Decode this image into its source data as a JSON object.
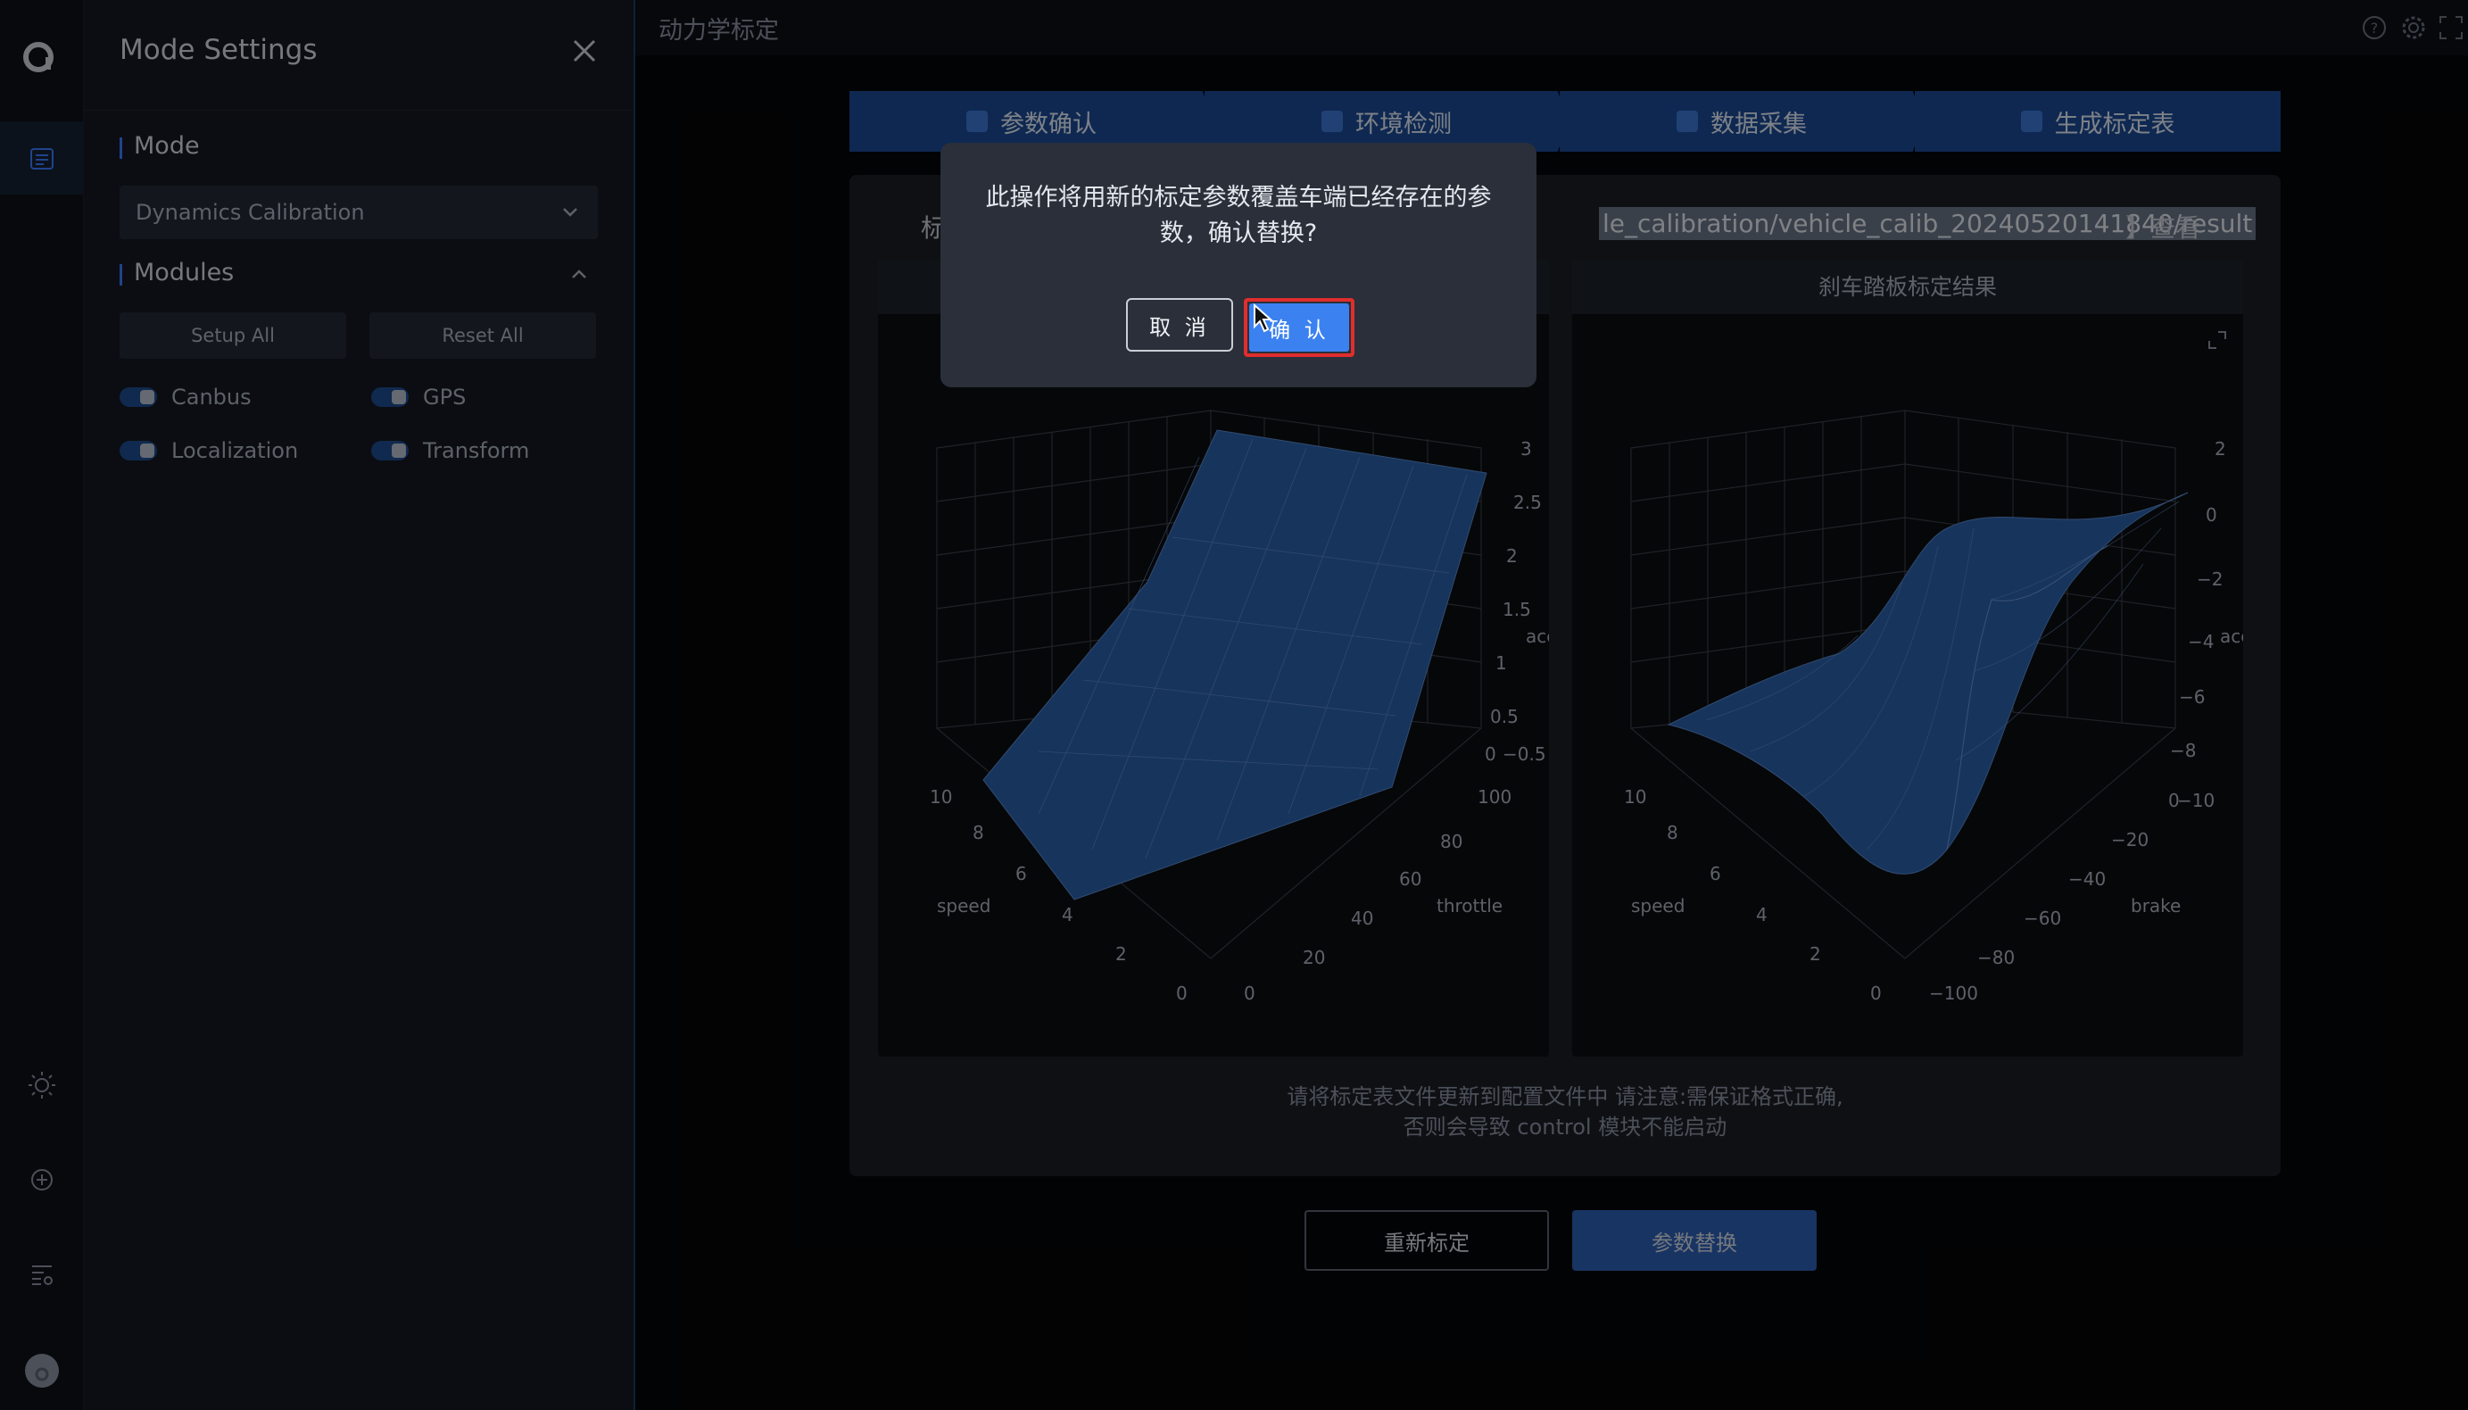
{
  "sidebar_rail": {
    "icons": [
      "logo-icon",
      "list-icon",
      "sun-icon",
      "add-circle-icon",
      "settings-list-icon",
      "avatar"
    ]
  },
  "panel": {
    "title": "Mode Settings",
    "mode_label": "Mode",
    "mode_value": "Dynamics Calibration",
    "modules_label": "Modules",
    "setup_all": "Setup All",
    "reset_all": "Reset All",
    "modules": [
      {
        "name": "Canbus",
        "on": true
      },
      {
        "name": "GPS",
        "on": true
      },
      {
        "name": "Localization",
        "on": true
      },
      {
        "name": "Transform",
        "on": true
      }
    ]
  },
  "topbar": {
    "page_title": "动力学标定",
    "icons": [
      "help-icon",
      "gear-icon",
      "fullscreen-icon"
    ]
  },
  "steps": [
    {
      "label": "参数确认"
    },
    {
      "label": "环境检测"
    },
    {
      "label": "数据采集"
    },
    {
      "label": "生成标定表"
    }
  ],
  "result": {
    "prefix": "标",
    "path": "le_calibration/vehicle_calib_20240520141840/result",
    "suffix": "】查看",
    "plot_left_title": "",
    "plot_right_title": "刹车踏板标定结果",
    "hint_line1": "请将标定表文件更新到配置文件中 请注意:需保证格式正确,",
    "hint_line2": "否则会导致 control 模块不能启动"
  },
  "buttons": {
    "recalibrate": "重新标定",
    "replace": "参数替换"
  },
  "dialog": {
    "message": "此操作将用新的标定参数覆盖车端已经存在的参数，确认替换?",
    "cancel": "取 消",
    "confirm": "确 认"
  },
  "plots": {
    "left": {
      "z_ticks": [
        "3",
        "2.5",
        "2",
        "1.5",
        "1",
        "0.5",
        "0",
        "−0.5"
      ],
      "z_label": "acc",
      "x_ticks": [
        "0",
        "20",
        "40",
        "60",
        "80",
        "100"
      ],
      "x_label": "throttle",
      "y_ticks": [
        "0",
        "2",
        "4",
        "6",
        "8",
        "10"
      ],
      "y_label": "speed"
    },
    "right": {
      "z_ticks": [
        "2",
        "0",
        "−2",
        "−4",
        "−6",
        "−8",
        "−10"
      ],
      "z_label": "acc",
      "x_ticks": [
        "−100",
        "−80",
        "−60",
        "−40",
        "−20",
        "0"
      ],
      "x_label": "brake",
      "y_ticks": [
        "0",
        "2",
        "4",
        "6",
        "8",
        "10"
      ],
      "y_label": "speed"
    }
  },
  "colors": {
    "accent": "#3b82f0",
    "step_bg": "#1b4a94",
    "highlight_border": "#e02d2d",
    "surface": "#2b5fa8"
  }
}
